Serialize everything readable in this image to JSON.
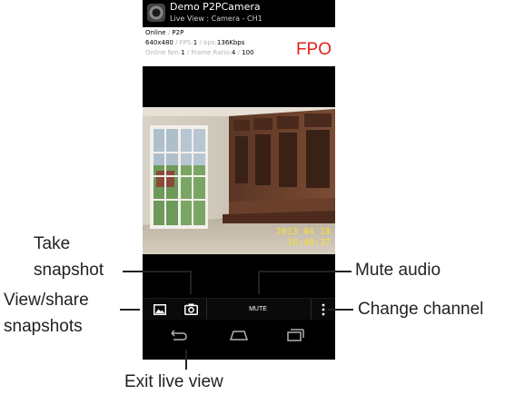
{
  "app": {
    "title": "Demo P2PCamera",
    "subtitle": "Live View : Camera - CH1"
  },
  "info": {
    "status": "Online",
    "sep1": " / ",
    "mode": "P2P",
    "resolution": "640x480",
    "sep2": " / FPS:",
    "fps": "1",
    "sep3": " / bps:",
    "bps": "136Kbps",
    "online_label": "Online Nm:",
    "online_num": "1",
    "ratio_label": " / Frame Ratio:",
    "ratio_a": "4",
    "ratio_sep": " / ",
    "ratio_b": "100"
  },
  "overlay_tag": "FPO",
  "video": {
    "date": "2013 04 18",
    "time": "16:40:37"
  },
  "toolbar": {
    "mute_label": "MUTE"
  },
  "callouts": {
    "take_snapshot_1": "Take",
    "take_snapshot_2": "snapshot",
    "view_share_1": "View/share",
    "view_share_2": "snapshots",
    "mute_audio": "Mute audio",
    "change_channel": "Change channel",
    "exit_live_view": "Exit live view"
  },
  "colors": {
    "fpo": "#e3201b",
    "timestamp": "#f4e235"
  },
  "icons": [
    "camera-icon",
    "gallery-icon",
    "overflow-menu-icon",
    "back-icon",
    "home-icon",
    "recents-icon"
  ]
}
